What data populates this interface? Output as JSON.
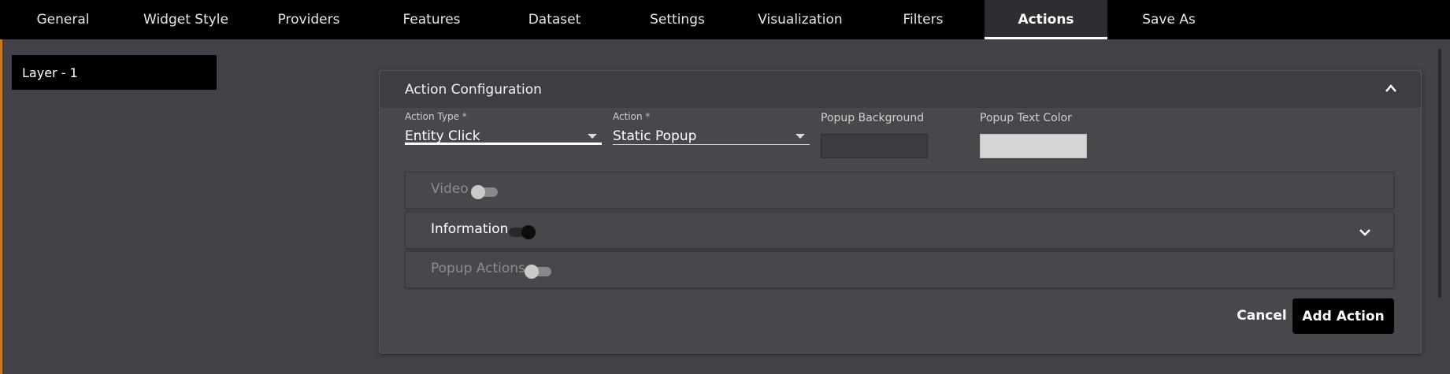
{
  "tabs": [
    {
      "label": "General"
    },
    {
      "label": "Widget Style"
    },
    {
      "label": "Providers"
    },
    {
      "label": "Features"
    },
    {
      "label": "Dataset"
    },
    {
      "label": "Settings"
    },
    {
      "label": "Visualization"
    },
    {
      "label": "Filters"
    },
    {
      "label": "Actions",
      "active": true
    },
    {
      "label": "Save As"
    }
  ],
  "sidebar": {
    "layer_label": "Layer - 1"
  },
  "card": {
    "title": "Action Configuration",
    "collapse_icon": "chevron-up-icon",
    "action_type": {
      "label": "Action Type",
      "required_mark": "*",
      "value": "Entity Click"
    },
    "action": {
      "label": "Action",
      "required_mark": "*",
      "value": "Static Popup"
    },
    "popup_background": {
      "label": "Popup Background",
      "color": "#3d3b40"
    },
    "popup_text_color": {
      "label": "Popup Text Color",
      "color": "#d6d6d6"
    },
    "sections": [
      {
        "label": "Video",
        "enabled": false
      },
      {
        "label": "Information",
        "enabled": true,
        "expand_icon": "chevron-down-icon"
      },
      {
        "label": "Popup Actions",
        "enabled": false
      }
    ],
    "cancel_label": "Cancel",
    "add_label": "Add Action"
  }
}
